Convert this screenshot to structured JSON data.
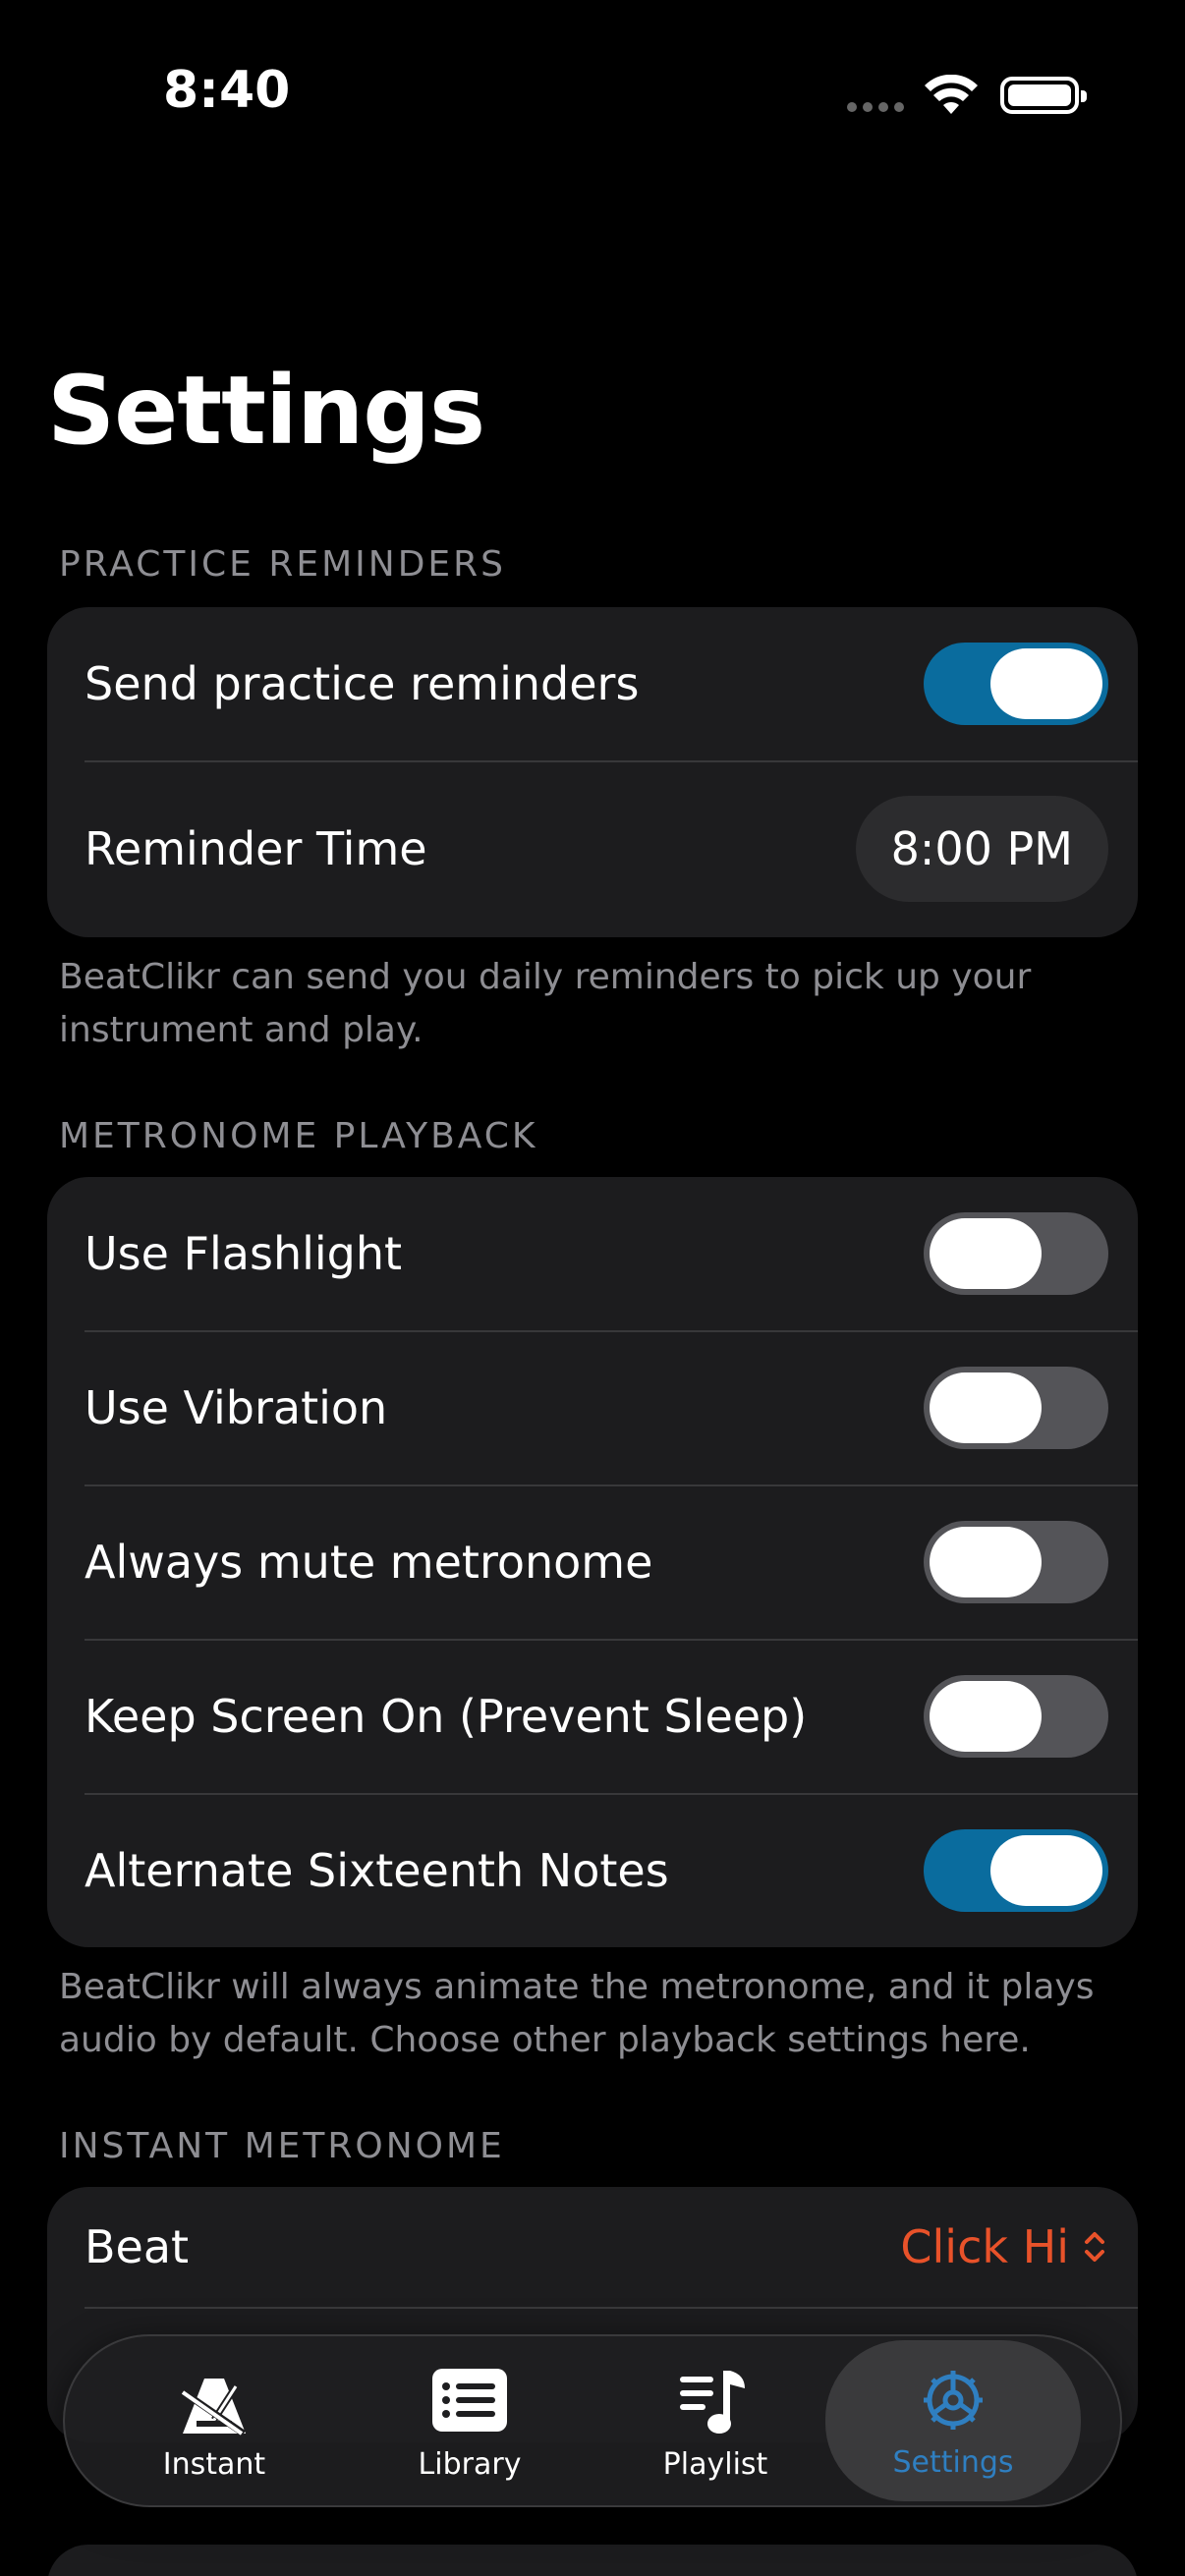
{
  "status_bar": {
    "time": "8:40"
  },
  "title": "Settings",
  "sections": {
    "practice": {
      "header": "PRACTICE REMINDERS",
      "send_label": "Send practice reminders",
      "send_on": true,
      "reminder_label": "Reminder Time",
      "reminder_value": "8:00 PM",
      "footer": "BeatClikr can send you daily reminders to pick up your instrument and play."
    },
    "playback": {
      "header": "METRONOME PLAYBACK",
      "rows": [
        {
          "label": "Use Flashlight",
          "on": false
        },
        {
          "label": "Use Vibration",
          "on": false
        },
        {
          "label": "Always mute metronome",
          "on": false
        },
        {
          "label": "Keep Screen On (Prevent Sleep)",
          "on": false
        },
        {
          "label": "Alternate Sixteenth Notes",
          "on": true
        }
      ],
      "footer": "BeatClikr will always animate the metronome, and it plays audio by default. Choose other playback settings here."
    },
    "instant": {
      "header": "INSTANT METRONOME",
      "beat_label": "Beat",
      "beat_value": "Click Hi"
    }
  },
  "tabbar": {
    "tabs": [
      {
        "label": "Instant",
        "icon": "metronome-icon"
      },
      {
        "label": "Library",
        "icon": "list-icon"
      },
      {
        "label": "Playlist",
        "icon": "music-list-icon"
      },
      {
        "label": "Settings",
        "icon": "gear-icon",
        "active": true
      }
    ]
  },
  "colors": {
    "accent_toggle": "#0a6c9e",
    "accent_orange": "#e8522a",
    "tab_active": "#2f7fc1"
  }
}
